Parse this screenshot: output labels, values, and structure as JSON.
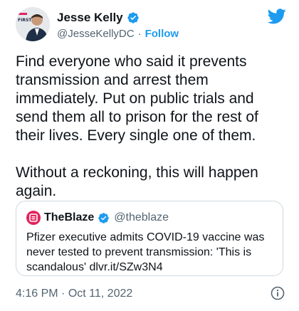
{
  "author": {
    "display_name": "Jesse Kelly",
    "handle": "@JesseKellyDC",
    "separator": "·",
    "follow_label": "Follow",
    "avatar_badge": "FIRST"
  },
  "tweet": {
    "paragraphs": [
      "Find everyone who said it prevents transmission and arrest them immediately. Put on public trials and send them all to prison for the rest of their lives. Every single one of them.",
      "Without a reckoning, this will happen again."
    ]
  },
  "quote": {
    "display_name": "TheBlaze",
    "handle": "@theblaze",
    "text": "Pfizer executive admits COVID-19 vaccine was never tested to prevent transmission: 'This is scandalous' dlvr.it/SZw3N4"
  },
  "meta": {
    "time": "4:16 PM",
    "separator": "·",
    "date": "Oct 11, 2022"
  },
  "colors": {
    "accent": "#1d9bf0",
    "text": "#0f1419",
    "secondary": "#536471",
    "blaze_red": "#e0245e"
  },
  "icons": {
    "verified": "verified-badge-icon",
    "twitter": "twitter-bird-icon",
    "info": "info-icon"
  }
}
